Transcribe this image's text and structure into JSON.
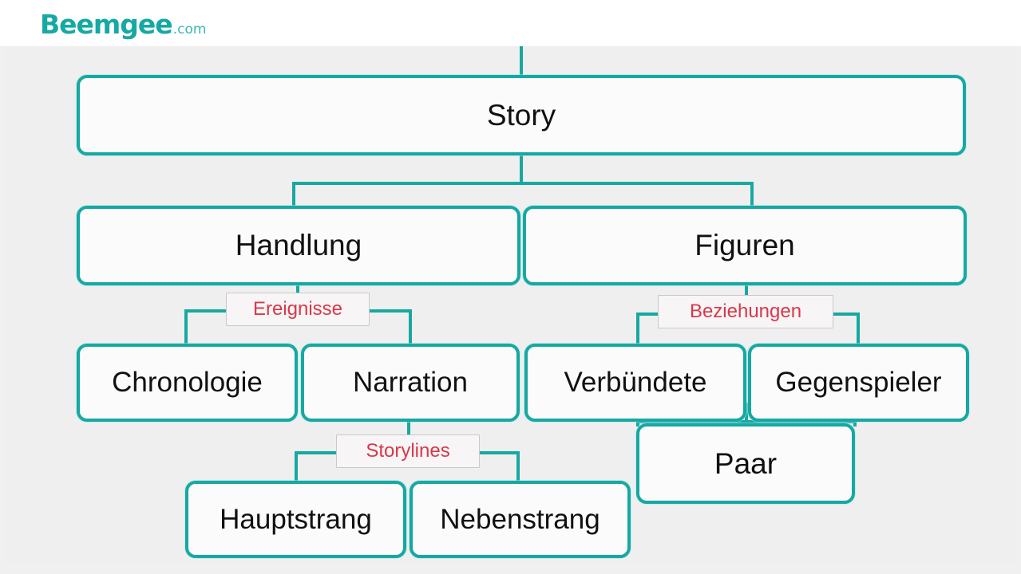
{
  "brand": {
    "name": "Beemgee",
    "tld": ".com",
    "color": "#16a9a3"
  },
  "diagram": {
    "title_node_clipped": "",
    "accent_color": "#17a8a2",
    "label_color": "#d9384a",
    "canvas_color": "#efefef",
    "node_fill": "#fbfbfb",
    "nodes": [
      {
        "id": "top",
        "label": ""
      },
      {
        "id": "story",
        "label": "Story"
      },
      {
        "id": "handlung",
        "label": "Handlung"
      },
      {
        "id": "figuren",
        "label": "Figuren"
      },
      {
        "id": "chronologie",
        "label": "Chronologie"
      },
      {
        "id": "narration",
        "label": "Narration"
      },
      {
        "id": "verbuendete",
        "label": "Verbündete"
      },
      {
        "id": "gegenspieler",
        "label": "Gegenspieler"
      },
      {
        "id": "paar",
        "label": "Paar"
      },
      {
        "id": "hauptstrang",
        "label": "Hauptstrang"
      },
      {
        "id": "nebenstrang",
        "label": "Nebenstrang"
      }
    ],
    "edge_labels": [
      {
        "id": "ereignisse",
        "label": "Ereignisse"
      },
      {
        "id": "beziehungen",
        "label": "Beziehungen"
      },
      {
        "id": "storylines",
        "label": "Storylines"
      }
    ]
  }
}
